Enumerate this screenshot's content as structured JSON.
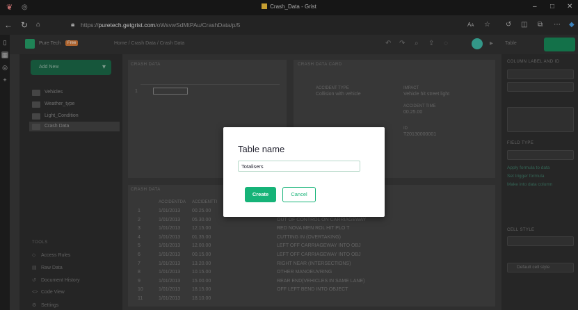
{
  "browser": {
    "window_title": "Crash_Data - Grist",
    "url_prefix": "https://",
    "url_host": "puretech.getgrist.com",
    "url_path": "/oWsvwSdMtPAu/CrashData/p/5",
    "read_aloud": "Aᴀ"
  },
  "app": {
    "site_name": "Pure Tech",
    "badge": "Free",
    "breadcrumb": "Home / Crash Data / Crash Data",
    "add_new": "Add New",
    "pages": [
      "Vehicles",
      "Weather_type",
      "Light_Condition",
      "Crash Data"
    ],
    "tools_title": "TOOLS",
    "tools": [
      "Access Rules",
      "Raw Data",
      "Document History",
      "Code View",
      "Settings"
    ],
    "return": "Help Center",
    "right_tab": "Table",
    "right_panel": {
      "title": "COLUMN LABEL AND ID",
      "field_label": "FIELD TYPE",
      "row_style": "CELL STYLE",
      "default_cell_style": "Default cell style",
      "link_apply": "Apply formula to data",
      "link_formula": "Set trigger formula",
      "link_make": "Make into data column"
    }
  },
  "main": {
    "top_left_title": "CRASH DATA",
    "top_right_title": "CRASH DATA CARD",
    "bottom_title": "CRASH DATA",
    "card_fields": [
      {
        "label": "ACCIDENT TYPE",
        "value": "Collision with vehicle"
      },
      {
        "label": "IMPACT",
        "value": "Vehicle hit street light"
      },
      {
        "label": "ACCIDENT TIME",
        "value": "00.25.00"
      },
      {
        "label": "ID",
        "value": "T20130000001"
      }
    ],
    "columns": [
      "ACCIDENTDA",
      "ACCIDENTTI",
      "",
      "",
      ""
    ],
    "rows": [
      [
        "1/01/2013",
        "00.25.00"
      ],
      [
        "1/01/2013",
        "05.30.00"
      ],
      [
        "1/01/2013",
        "12.15.00"
      ],
      [
        "1/01/2013",
        "01.35.00"
      ],
      [
        "1/01/2013",
        "12.00.00"
      ],
      [
        "1/01/2013",
        "00.15.00"
      ],
      [
        "1/01/2013",
        "13.20.00"
      ],
      [
        "1/01/2013",
        "10.15.00"
      ],
      [
        "1/01/2013",
        "15.00.00"
      ],
      [
        "1/01/2013",
        "18.15.00"
      ],
      [
        "1/01/2013",
        "18.10.00"
      ]
    ],
    "row_desc": [
      "RED NOVA MEN ROL HIT PLO T",
      "OUT OF CONTROL ON CARRIAGEWAY",
      "RED NOVA MEN ROL HIT PLO T",
      "CUTTING IN (OVERTAKING)",
      "LEFT OFF CARRIAGEWAY INTO OBJ",
      "LEFT OFF CARRIAGEWAY INTO OBJ",
      "RIGHT NEAR (INTERSECTIONS)",
      "OTHER MANOEUVRING",
      "REAR END(VEHICLES IN SAME LANE)",
      "OFF LEFT BEND INTO OBJECT"
    ]
  },
  "modal": {
    "title": "Table name",
    "input_value": "Totalisers",
    "create_label": "Create",
    "cancel_label": "Cancel"
  }
}
